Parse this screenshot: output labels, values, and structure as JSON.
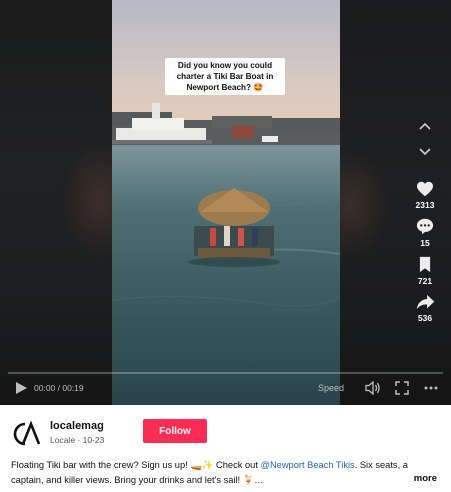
{
  "video": {
    "overlay_text": "Did you know you could charter a Tiki Bar Boat in Newport Beach? 🤩"
  },
  "side_actions": {
    "likes": "2313",
    "comments": "15",
    "saves": "721",
    "shares": "536"
  },
  "player": {
    "time_display": "00:00 / 00:19",
    "speed_label": "Speed",
    "progress": 0
  },
  "post": {
    "username": "localemag",
    "meta": "Locale · 10-23",
    "follow_label": "Follow",
    "description_before": "Floating Tiki bar with the crew? Sign us up! 🚤✨ Check out ",
    "mention": "@Newport Beach Tikis",
    "description_after": ". Six seats, a captain, and killer views. Bring your drinks and let's sail! 🍹…",
    "more_label": "more"
  },
  "colors": {
    "follow_button": "#fe2c55",
    "mention": "#2b5fb4",
    "player_background": "#141414"
  },
  "icons": [
    "chevron-up-icon",
    "chevron-down-icon",
    "heart-icon",
    "comment-icon",
    "bookmark-icon",
    "share-icon",
    "play-icon",
    "volume-icon",
    "fullscreen-icon",
    "more-options-icon"
  ]
}
